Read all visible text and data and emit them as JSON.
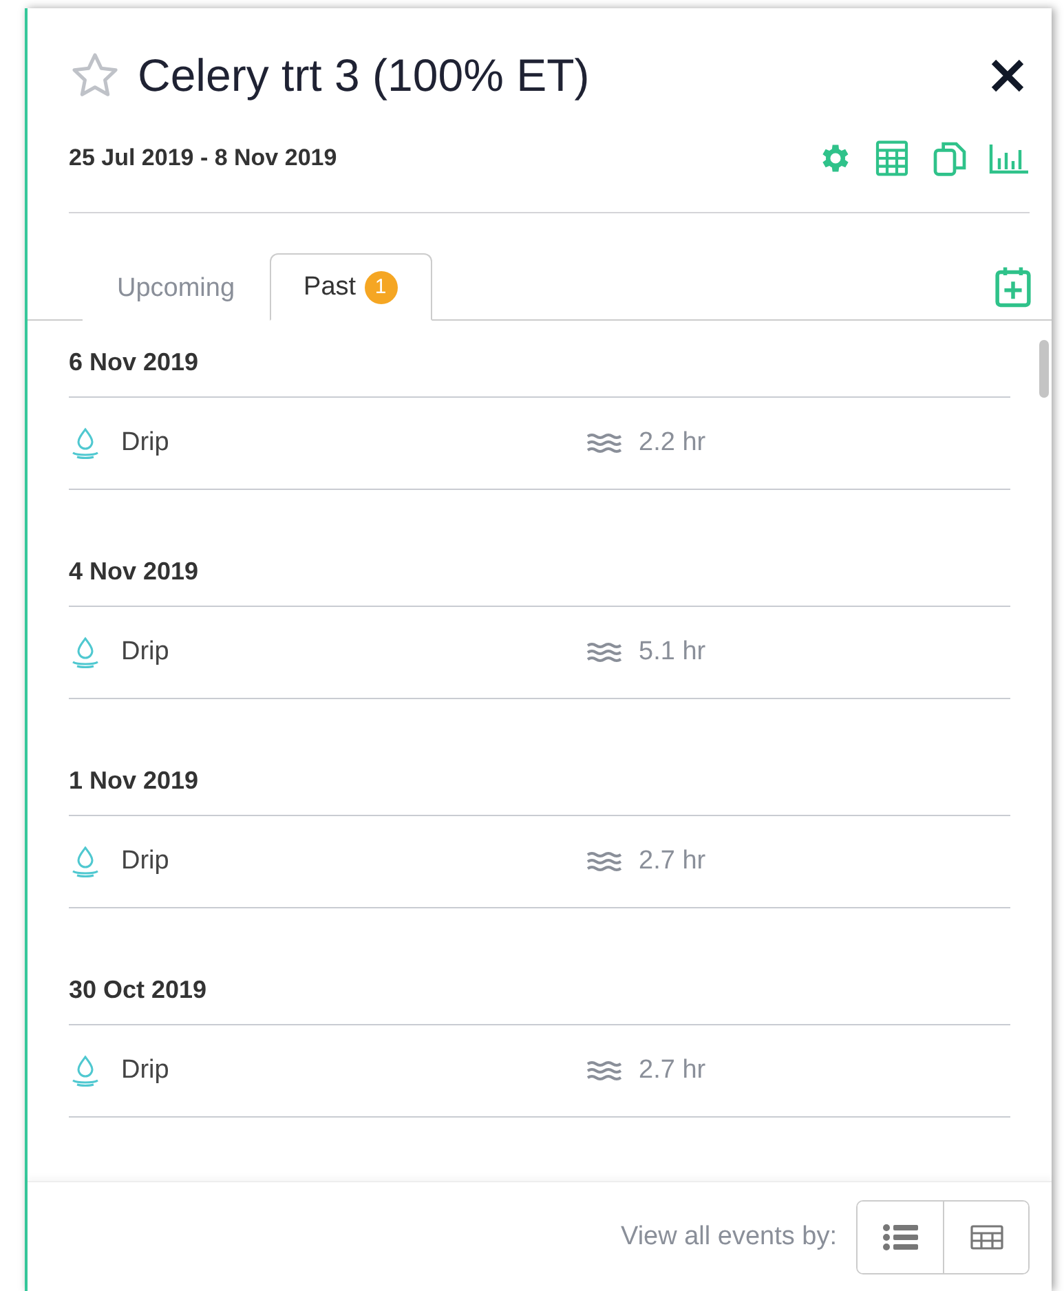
{
  "header": {
    "title": "Celery trt 3 (100% ET)",
    "starred": false,
    "date_range": "25 Jul 2019 - 8 Nov 2019"
  },
  "tabs": [
    {
      "label": "Upcoming",
      "selected": false
    },
    {
      "label": "Past",
      "selected": true,
      "badge": "1"
    }
  ],
  "events": [
    {
      "date": "6 Nov 2019",
      "items": [
        {
          "method": "Drip",
          "duration": "2.2 hr"
        }
      ]
    },
    {
      "date": "4 Nov 2019",
      "items": [
        {
          "method": "Drip",
          "duration": "5.1 hr"
        }
      ]
    },
    {
      "date": "1 Nov 2019",
      "items": [
        {
          "method": "Drip",
          "duration": "2.7 hr"
        }
      ]
    },
    {
      "date": "30 Oct 2019",
      "items": [
        {
          "method": "Drip",
          "duration": "2.7 hr"
        }
      ]
    }
  ],
  "footer": {
    "label": "View all events by:"
  }
}
